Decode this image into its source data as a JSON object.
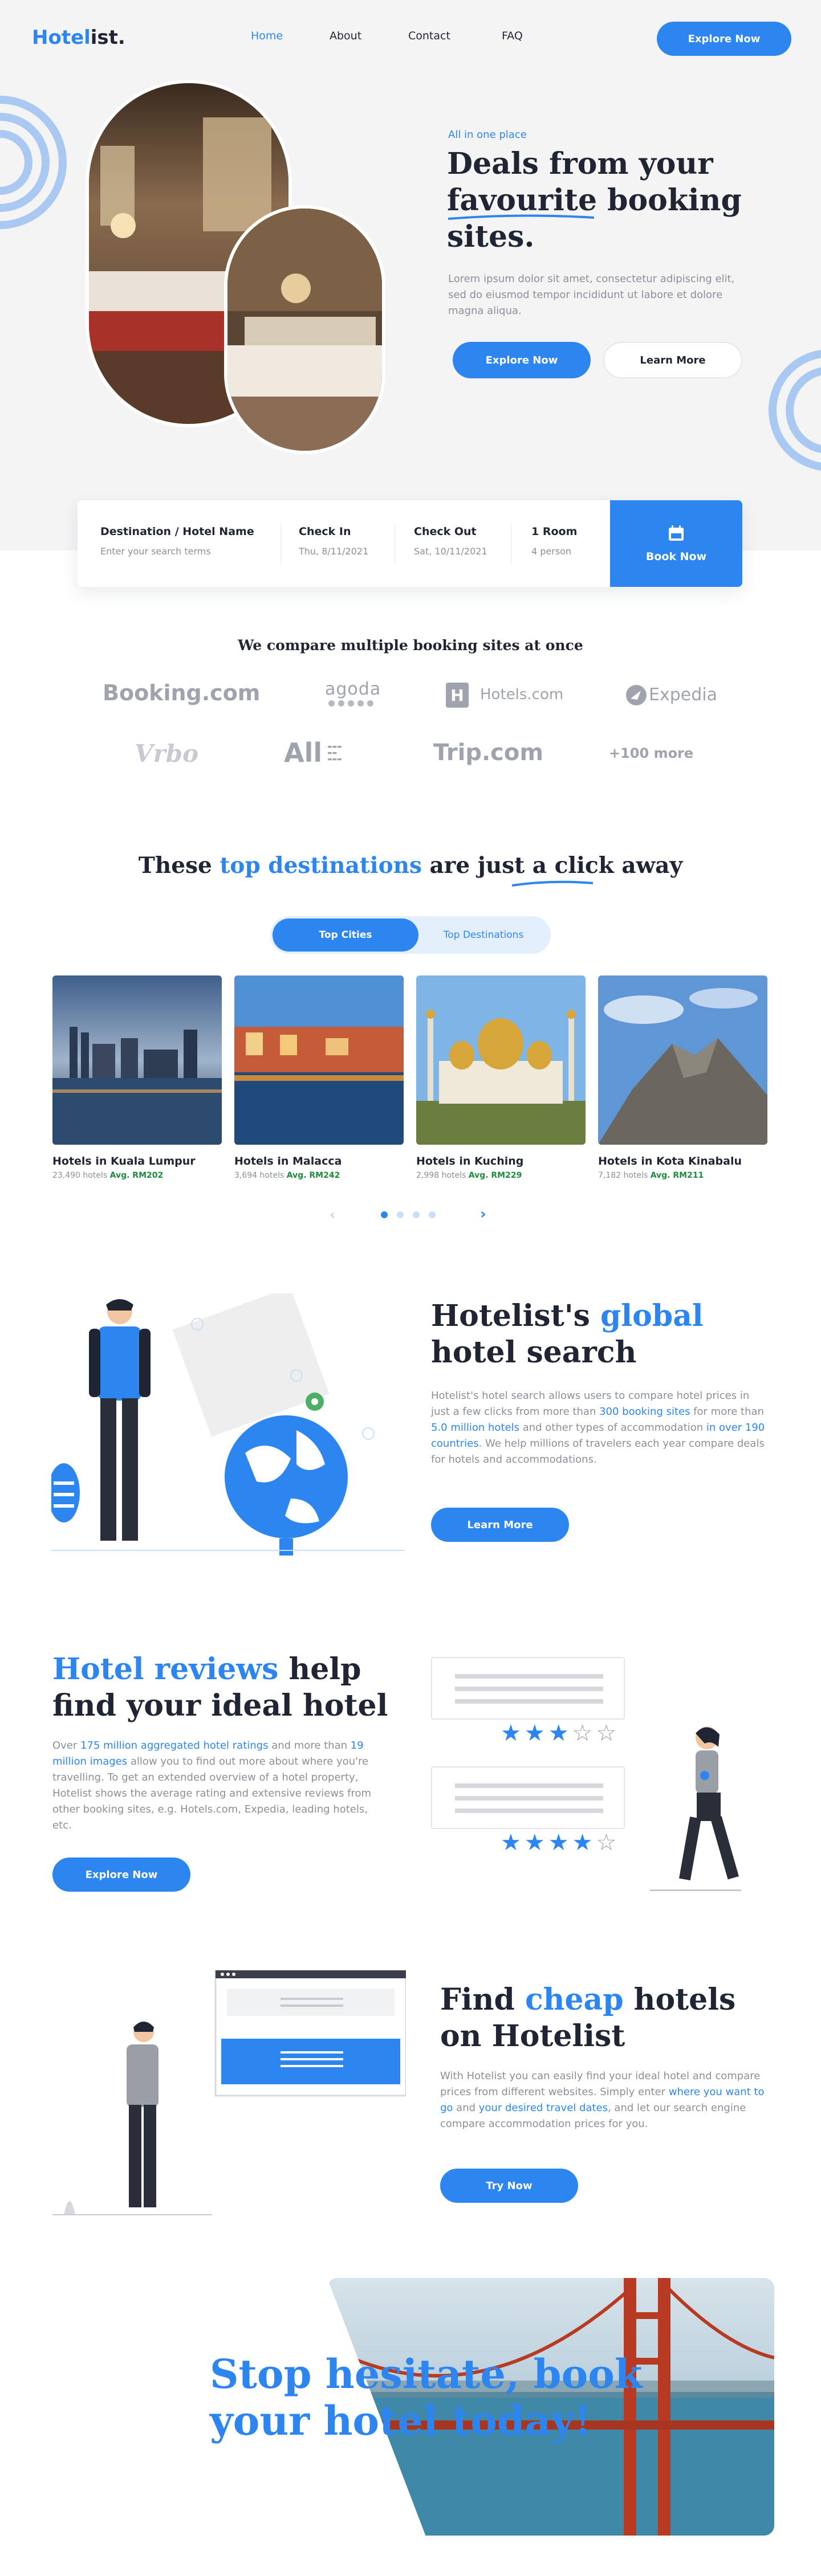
{
  "header": {
    "logo_main": "Hotel",
    "logo_accent": "ist.",
    "nav": [
      "Home",
      "About",
      "Contact",
      "FAQ"
    ],
    "cta": "Explore Now"
  },
  "hero": {
    "eyebrow": "All in one place",
    "title_line1": "Deals from your",
    "title_line2": "favourite booking",
    "title_line3": "sites.",
    "body": "Lorem ipsum dolor sit amet, consectetur adipiscing elit, sed do eiusmod tempor incididunt ut labore et dolore magna aliqua.",
    "btn_primary": "Explore Now",
    "btn_secondary": "Learn More"
  },
  "search": {
    "dest_label": "Destination / Hotel Name",
    "dest_placeholder": "Enter your search terms",
    "checkin_label": "Check In",
    "checkin_value": "Thu, 8/11/2021",
    "checkout_label": "Check Out",
    "checkout_value": "Sat, 10/11/2021",
    "room_label": "1 Room",
    "room_value": "4 person",
    "book_label": "Book Now"
  },
  "partners": {
    "title": "We compare multiple booking sites at once",
    "logos": [
      "Booking.com",
      "agoda",
      "Hotels.com",
      "Expedia",
      "Vrbo",
      "All",
      "Trip.com",
      "+100 more"
    ]
  },
  "destinations": {
    "title_pre": "These ",
    "title_hl": "top destinations",
    "title_post": " are just a click away",
    "tab_active": "Top Cities",
    "tab_inactive": "Top Destinations",
    "cities": [
      {
        "name": "Hotels in Kuala Lumpur",
        "count": "23,490 hotels",
        "avg": "Avg. RM202"
      },
      {
        "name": "Hotels in Malacca",
        "count": "3,694 hotels",
        "avg": "Avg. RM242"
      },
      {
        "name": "Hotels in Kuching",
        "count": "2,998 hotels",
        "avg": "Avg. RM229"
      },
      {
        "name": "Hotels in Kota Kinabalu",
        "count": "7,182 hotels",
        "avg": "Avg. RM211"
      }
    ]
  },
  "global": {
    "title_pre": "Hotelist's ",
    "title_hl": "global",
    "title_line2": "hotel search",
    "p1": "Hotelist's hotel search allows users to compare hotel prices in just a few clicks from more than ",
    "hl1": "300 booking sites",
    "p2": " for more than ",
    "hl2": "5.0 million hotels",
    "p3": " and other types of accommodation ",
    "hl3": "in over 190 countries",
    "p4": ". We help millions of travelers each year compare deals for hotels and accommodations.",
    "cta": "Learn More"
  },
  "reviews": {
    "title_hl": "Hotel reviews",
    "title_post": " help",
    "title_line2": "find your ideal hotel",
    "p0": "Over ",
    "hl1": "175 million aggregated hotel ratings",
    "p1": " and more than ",
    "hl2": "19 million images",
    "p2": " allow you to find out more about where you're travelling. To get an extended overview of a hotel property, Hotelist shows the average rating and extensive reviews from other booking sites, e.g. Hotels.com, Expedia, leading hotels, etc.",
    "cta": "Explore Now",
    "rating1": 3,
    "rating2": 4
  },
  "cheap": {
    "title_pre": "Find ",
    "title_hl": "cheap",
    "title_post": " hotels",
    "title_line2": "on Hotelist",
    "p0": "With Hotelist you can easily find your ideal hotel and compare prices from different websites. Simply enter ",
    "hl1": "where you want to go",
    "p1": " and ",
    "hl2": "your desired travel dates",
    "p2": ", and let our search engine compare accommodation prices for you.",
    "cta": "Try Now"
  },
  "footer_banner": {
    "line1": "Stop hesitate, book",
    "line2": "your hotel today!"
  },
  "colors": {
    "accent": "#2d86f0",
    "price": "#1e8a3e"
  }
}
